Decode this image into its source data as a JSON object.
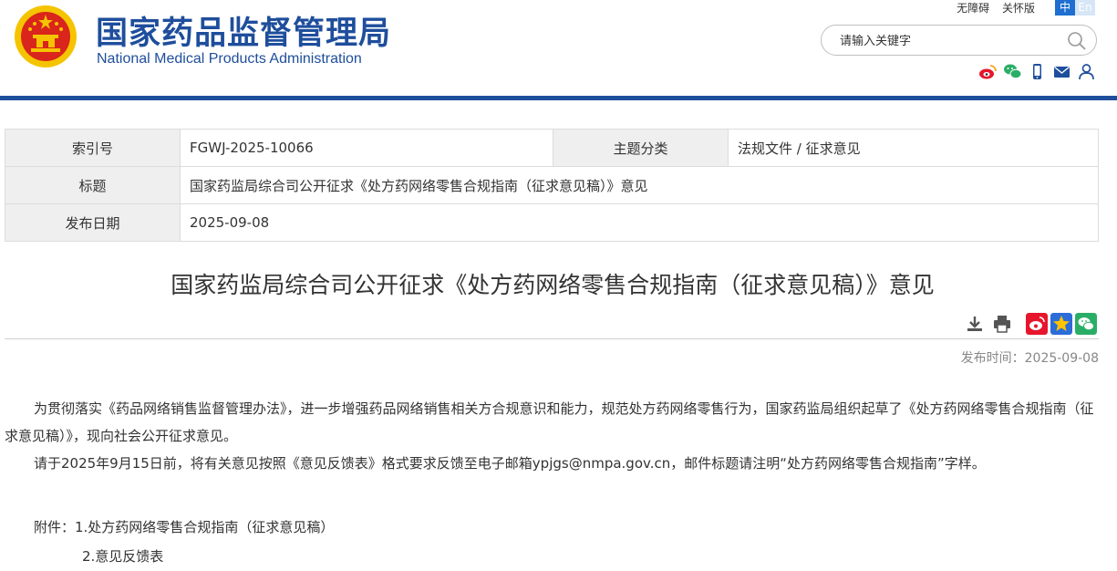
{
  "header": {
    "title_cn": "国家药品监督管理局",
    "title_en": "National Medical Products Administration",
    "links": [
      "无障碍",
      "关怀版"
    ],
    "lang": [
      "中",
      "En"
    ],
    "search_placeholder": "请输入关键字",
    "colors": {
      "brand": "#1e4e9c",
      "emblem_red": "#d9251c",
      "emblem_gold": "#f5c400"
    }
  },
  "info": {
    "index_label": "索引号",
    "index_value": "FGWJ-2025-10066",
    "category_label": "主题分类",
    "category_value": "法规文件 / 征求意见",
    "title_label": "标题",
    "title_value": "国家药监局综合司公开征求《处方药网络零售合规指南（征求意见稿）》意见",
    "date_label": "发布日期",
    "date_value": "2025-09-08"
  },
  "article": {
    "title": "国家药监局综合司公开征求《处方药网络零售合规指南（征求意见稿）》意见",
    "publish_time": "发布时间：2025-09-08",
    "paragraph1": "为贯彻落实《药品网络销售监督管理办法》，进一步增强药品网络销售相关方合规意识和能力，规范处方药网络零售行为，国家药监局组织起草了《处方药网络零售合规指南（征求意见稿）》，现向社会公开征求意见。",
    "paragraph2": "请于2025年9月15日前，将有关意见按照《意见反馈表》格式要求反馈至电子邮箱ypjgs@nmpa.gov.cn，邮件标题请注明“处方药网络零售合规指南”字样。",
    "attachment1": "附件：1.处方药网络零售合规指南（征求意见稿）",
    "attachment2": "2.意见反馈表"
  }
}
